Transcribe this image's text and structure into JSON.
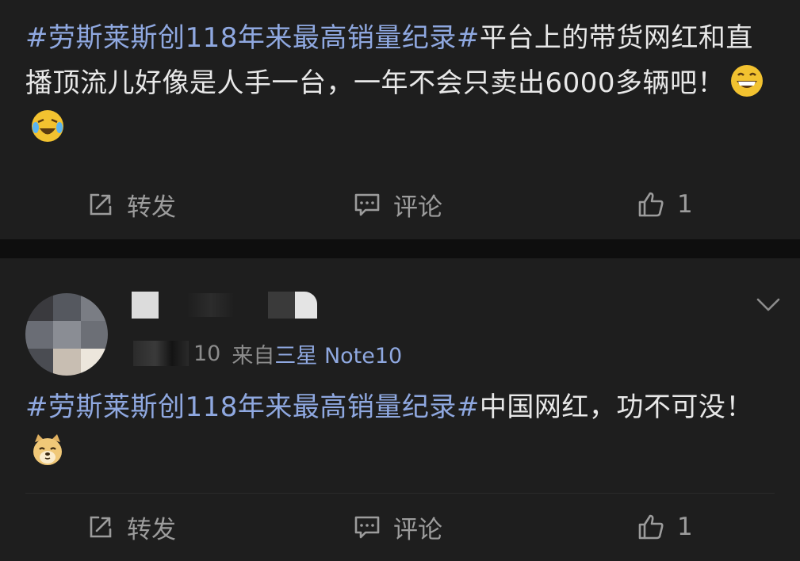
{
  "posts": [
    {
      "topic": "#劳斯莱斯创118年来最高销量纪录#",
      "text": "平台上的带货网红和直播顶流儿好像是人手一台，一年不会只卖出6000多辆吧！",
      "emojis": [
        "grin-emoji",
        "laugh-cry-emoji"
      ],
      "actions": {
        "repost": "转发",
        "comment": "评论",
        "like_count": "1"
      }
    },
    {
      "time_partial": "10",
      "source_prefix": "来自",
      "device": "三星 Note10",
      "topic": "#劳斯莱斯创118年来最高销量纪录#",
      "text": "中国网红，功不可没！",
      "emojis": [
        "doge-emoji"
      ],
      "actions": {
        "repost": "转发",
        "comment": "评论",
        "like_count": "1"
      }
    }
  ],
  "colors": {
    "topic": "#8fa8e0",
    "text": "#e8e8e8",
    "muted": "#9c9c9c",
    "background": "#1e1e1e"
  }
}
